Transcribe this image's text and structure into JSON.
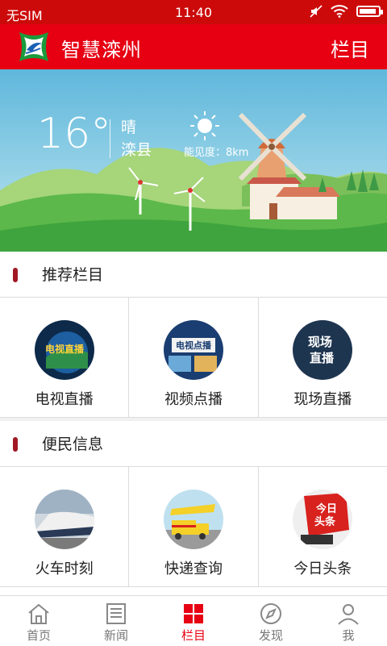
{
  "status_bar": {
    "carrier": "无SIM",
    "time": "11:40"
  },
  "header": {
    "title": "智慧滦州",
    "right_action": "栏目"
  },
  "weather": {
    "temperature": "16°",
    "condition": "晴",
    "location": "滦县",
    "visibility": "能见度：8km"
  },
  "sections": [
    {
      "title": "推荐栏目",
      "items": [
        {
          "label": "电视直播",
          "icon": "tv-live-icon"
        },
        {
          "label": "视频点播",
          "icon": "video-on-demand-icon"
        },
        {
          "label": "现场直播",
          "icon": "live-scene-icon"
        }
      ]
    },
    {
      "title": "便民信息",
      "items": [
        {
          "label": "火车时刻",
          "icon": "train-icon"
        },
        {
          "label": "快递查询",
          "icon": "delivery-truck-icon"
        },
        {
          "label": "今日头条",
          "icon": "headline-news-icon"
        }
      ]
    }
  ],
  "icon_text": {
    "tv": "电视直播",
    "video": "电视点播",
    "scene_top": "现场",
    "scene_bottom": "直播",
    "news_top": "今日",
    "news_bottom": "头条"
  },
  "tabs": [
    {
      "label": "首页",
      "icon": "home-icon",
      "active": false
    },
    {
      "label": "新闻",
      "icon": "news-icon",
      "active": false
    },
    {
      "label": "栏目",
      "icon": "grid-icon",
      "active": true
    },
    {
      "label": "发现",
      "icon": "compass-icon",
      "active": false
    },
    {
      "label": "我",
      "icon": "user-icon",
      "active": false
    }
  ],
  "colors": {
    "brand_red": "#e60012",
    "status_red": "#cc0a0a",
    "section_marker": "#a01822"
  }
}
